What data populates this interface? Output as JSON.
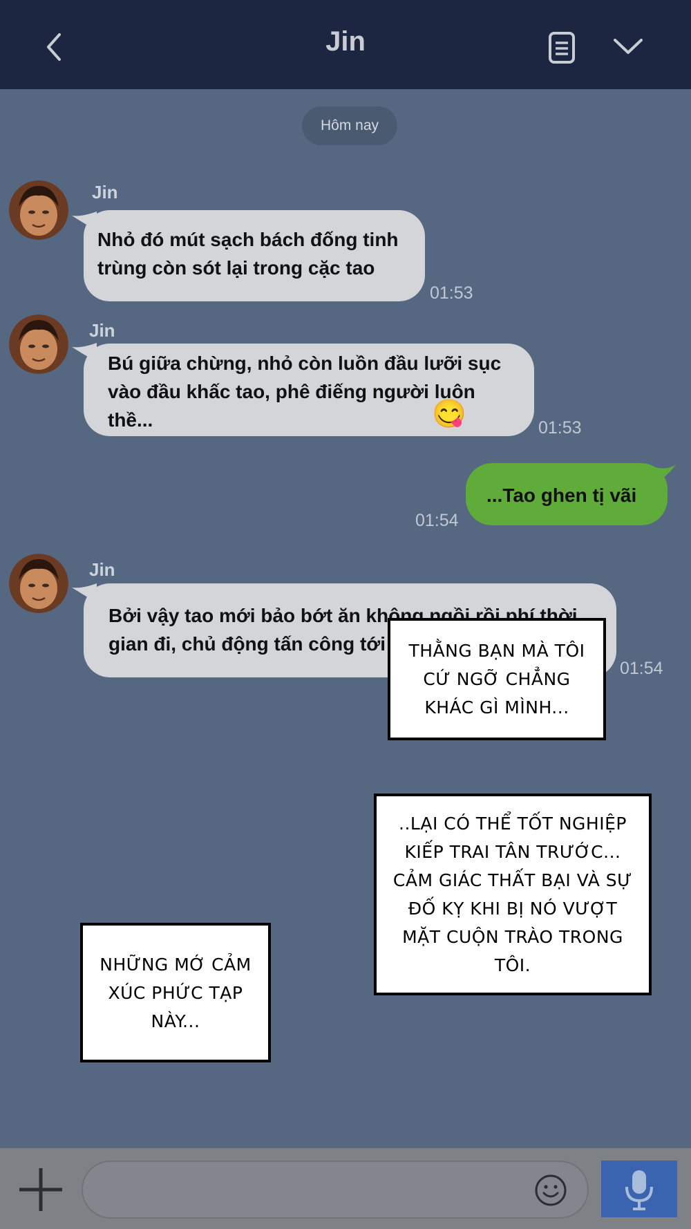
{
  "header": {
    "title": "Jin",
    "back_icon": "chevron-left-icon",
    "notes_icon": "document-icon",
    "menu_icon": "chevron-down-icon"
  },
  "chat": {
    "date_label": "Hôm nay",
    "messages": [
      {
        "sender": "Jin",
        "text": "Nhỏ đó mút sạch bách đống tinh trùng còn sót lại trong cặc tao",
        "time": "01:53",
        "direction": "in"
      },
      {
        "sender": "Jin",
        "text": "Bú giữa chừng, nhỏ còn luồn đầu lưỡi sục vào đầu khấc tao, phê điếng người luôn thề...",
        "emoji": "😋",
        "time": "01:53",
        "direction": "in"
      },
      {
        "sender": "",
        "text": "...Tao ghen tị vãi",
        "time": "01:54",
        "direction": "out"
      },
      {
        "sender": "Jin",
        "text": "Bởi vậy tao mới bảo bớt ăn không ngồi rồi phí thời gian đi, chủ động tấn công tới",
        "time": "01:54",
        "direction": "in"
      }
    ]
  },
  "captions": [
    "THẰNG BẠN MÀ TÔI CỨ NGỠ CHẲNG KHÁC GÌ MÌNH...",
    "..LẠI CÓ THỂ TỐT NGHIỆP KIẾP TRAI TÂN TRƯỚC... CẢM GIÁC THẤT BẠI VÀ SỰ ĐỐ KỴ KHI BỊ NÓ VƯỢT MẶT CUỘN TRÀO TRONG TÔI.",
    "NHỮNG MỚ CẢM XÚC PHỨC TẠP NÀY..."
  ],
  "input_bar": {
    "add_icon": "plus-icon",
    "emoji_icon": "smiley-icon",
    "mic_icon": "microphone-icon"
  },
  "colors": {
    "header_bg": "#1c2640",
    "chat_bg": "#566781",
    "incoming_bubble": "#d4d5d8",
    "outgoing_bubble": "#5fac3a",
    "mic_button": "#3a64b0"
  }
}
